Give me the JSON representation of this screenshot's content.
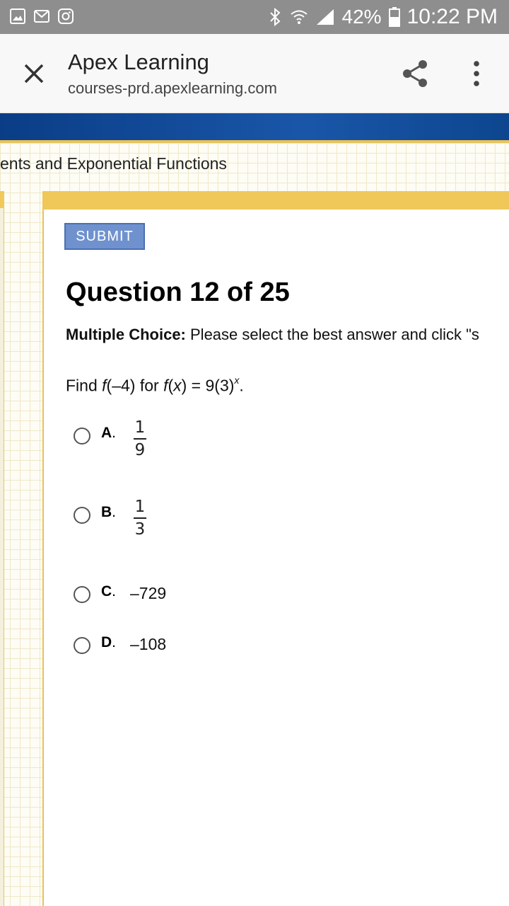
{
  "status_bar": {
    "battery": "42%",
    "time": "10:22 PM",
    "icons": [
      "image-icon",
      "gmail-icon",
      "instagram-icon",
      "bluetooth-icon",
      "wifi-icon",
      "signal-icon",
      "battery-icon"
    ]
  },
  "browser": {
    "title": "Apex Learning",
    "url": "courses-prd.apexlearning.com",
    "icons": [
      "close-icon",
      "share-icon",
      "more-vert-icon"
    ]
  },
  "unit_title": "ents and Exponential Functions",
  "submit_label": "SUBMIT",
  "question": {
    "title": "Question 12 of 25",
    "instructions_label": "Multiple Choice:",
    "instructions_text": " Please select the best answer and click \"s",
    "prompt_find": "Find ",
    "prompt_f1": "f",
    "prompt_arg": "(–4) for ",
    "prompt_f2": "f",
    "prompt_paren_open": "(",
    "prompt_x": "x",
    "prompt_eq": ") = 9(3)",
    "prompt_exp": "x",
    "prompt_end": ".",
    "options": [
      {
        "letter": "A",
        "numerator": "1",
        "denominator": "9"
      },
      {
        "letter": "B",
        "numerator": "1",
        "denominator": "3"
      },
      {
        "letter": "C",
        "value": "–729"
      },
      {
        "letter": "D",
        "value": "–108"
      }
    ]
  },
  "colors": {
    "status_bar": "#8e8e8e",
    "banner": "#1a56a8",
    "gold": "#f0c85a",
    "submit": "#6f92cf"
  }
}
